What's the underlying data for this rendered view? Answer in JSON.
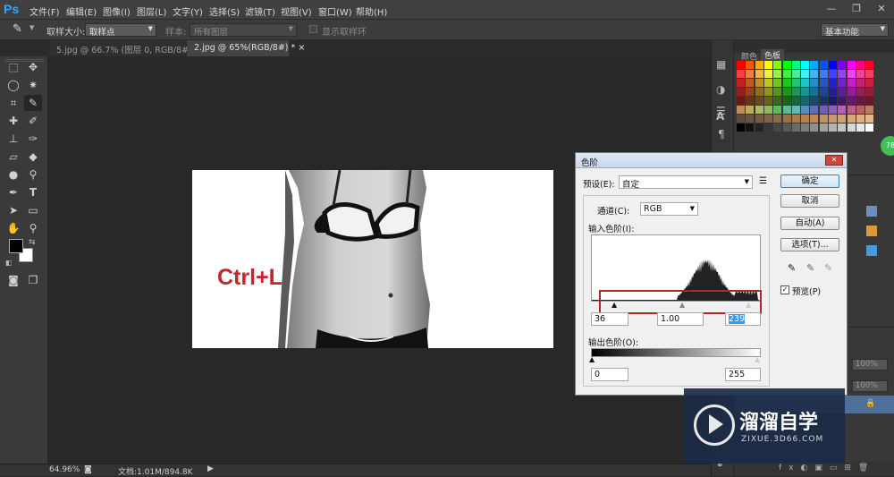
{
  "app": {
    "logo": "Ps"
  },
  "menu": [
    "文件(F)",
    "编辑(E)",
    "图像(I)",
    "图层(L)",
    "文字(Y)",
    "选择(S)",
    "滤镜(T)",
    "视图(V)",
    "窗口(W)",
    "帮助(H)"
  ],
  "window_controls": {
    "minimize": "—",
    "restore": "❐",
    "close": "✕"
  },
  "options": {
    "sample_size_label": "取样大小:",
    "sample_size_value": "取样点",
    "sample_label": "样本:",
    "sample_value": "所有图层",
    "show_ring": "显示取样环",
    "workspace": "基本功能"
  },
  "tabs": [
    {
      "label": "5.jpg @ 66.7% (图层 0, RGB/8#) *",
      "close": "×"
    },
    {
      "label": "2.jpg @ 65%(RGB/8#) *",
      "close": "×"
    }
  ],
  "canvas": {
    "overlay_text": "Ctrl+L",
    "overlay_color": "#c1272d"
  },
  "status": {
    "zoom": "64.96%",
    "doc": "文档:1.01M/894.8K"
  },
  "panel": {
    "tabs": [
      "颜色",
      "色板"
    ],
    "badge": "78"
  },
  "layers_opacity": [
    "100%",
    "100%"
  ],
  "dialog": {
    "title": "色阶",
    "preset_label": "预设(E):",
    "preset_value": "自定",
    "channel_label": "通道(C):",
    "channel_value": "RGB",
    "input_label": "输入色阶(I):",
    "input_values": [
      "36",
      "1.00",
      "239"
    ],
    "output_label": "输出色阶(O):",
    "output_values": [
      "0",
      "255"
    ],
    "buttons": {
      "ok": "确定",
      "cancel": "取消",
      "auto": "自动(A)",
      "options": "选项(T)..."
    },
    "preview_label": "预览(P)"
  },
  "watermark": {
    "brand": "溜溜自学",
    "url": "ZIXUE.3D66.COM"
  },
  "colors": {
    "accent": "#31a8ff",
    "highlight_box": "#b0262d",
    "watermark_bg": "#1c2a46"
  }
}
